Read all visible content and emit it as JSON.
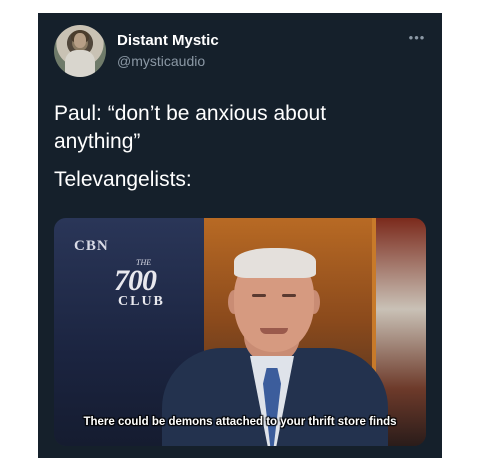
{
  "tweet": {
    "display_name": "Distant Mystic",
    "handle": "@mysticaudio",
    "more_icon": "more-horizontal-icon",
    "text_line1": "Paul: “don’t be anxious about anything”",
    "text_line2": "Televangelists:"
  },
  "media": {
    "logo_network": "CBN",
    "logo_the": "THE",
    "logo_number": "700",
    "logo_club": "CLUB",
    "caption": "There could be demons attached to your thrift store finds"
  },
  "colors": {
    "card_background": "#15202b",
    "secondary_text": "#8b98a5",
    "primary_text": "#ffffff"
  }
}
